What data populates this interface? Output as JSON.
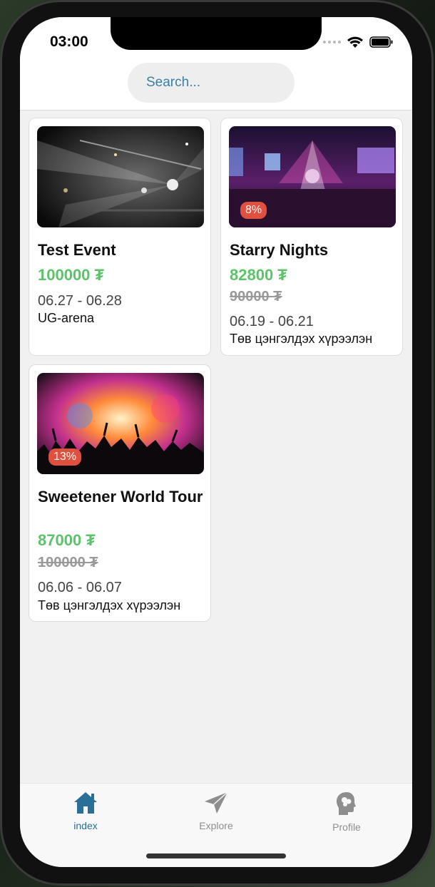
{
  "status_bar": {
    "time": "03:00"
  },
  "search": {
    "placeholder": "Search..."
  },
  "events": [
    {
      "title": "Test Event",
      "price": "100000 ₮",
      "old_price": "",
      "discount": "",
      "dates": "06.27 - 06.28",
      "venue": "UG-arena"
    },
    {
      "title": "Starry Nights",
      "price": "82800 ₮",
      "old_price": "90000 ₮",
      "discount": "8%",
      "dates": "06.19 - 06.21",
      "venue": "Төв цэнгэлдэх хүрээлэн"
    },
    {
      "title": "Sweetener World Tour",
      "price": "87000 ₮",
      "old_price": "100000 ₮",
      "discount": "13%",
      "dates": "06.06 - 06.07",
      "venue": "Төв цэнгэлдэх хүрээлэн"
    }
  ],
  "tabs": [
    {
      "label": "index",
      "icon": "home-icon",
      "active": true
    },
    {
      "label": "Explore",
      "icon": "paper-plane-icon",
      "active": false
    },
    {
      "label": "Profile",
      "icon": "head-brain-icon",
      "active": false
    }
  ],
  "colors": {
    "accent": "#2a6f97",
    "price": "#5cc36b",
    "badge": "#e0503f",
    "inactive_tab": "#8e8e8e"
  }
}
